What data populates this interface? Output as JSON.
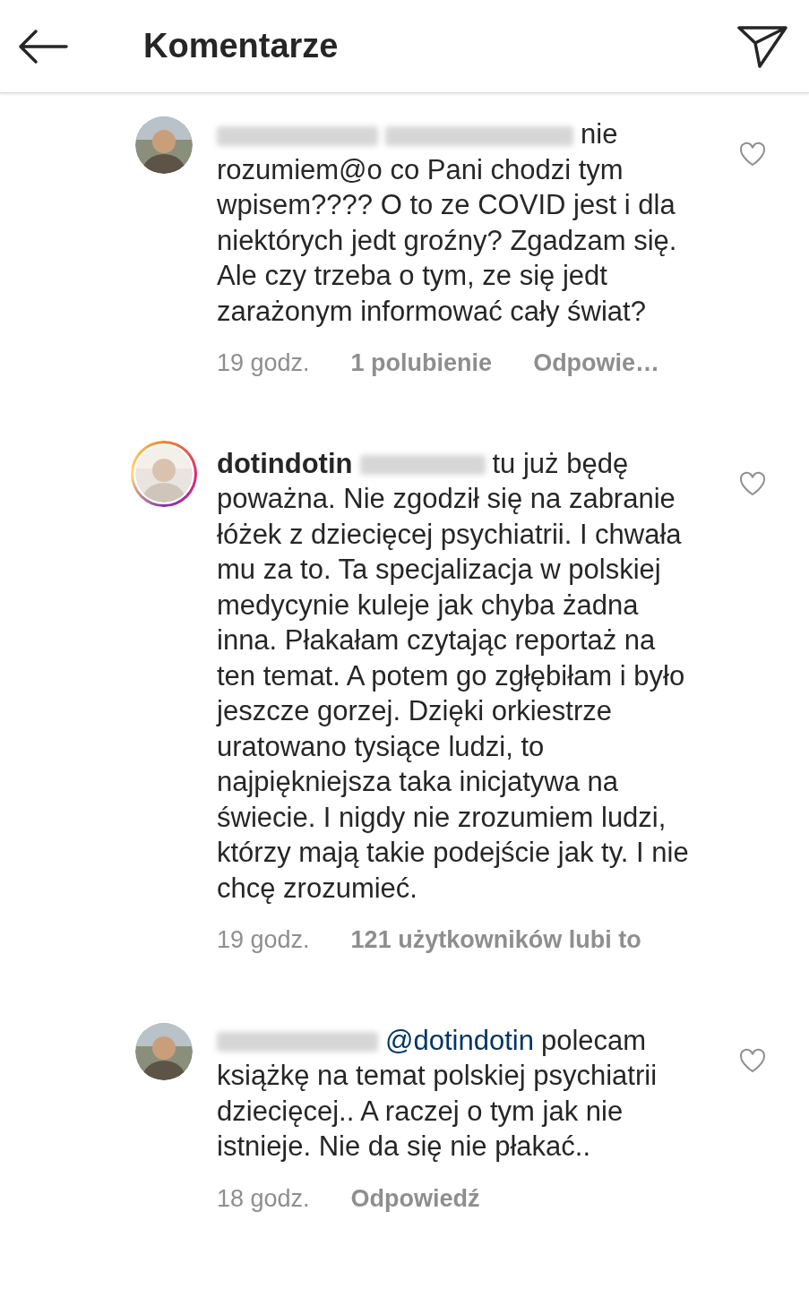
{
  "header": {
    "title": "Komentarze"
  },
  "comments": [
    {
      "username_hidden": true,
      "mention_hidden": true,
      "story_ring": false,
      "text": "nie rozumiem@o co Pani chodzi tym wpisem???? O to ze COVID jest i dla niektórych jedt groźny? Zgadzam się. Ale czy trzeba o tym, ze się jedt zarażonym informować cały świat?",
      "time": "19 godz.",
      "likes": "1 polubienie",
      "reply": "Odpowie…"
    },
    {
      "username": "dotindotin",
      "mention_hidden": true,
      "story_ring": true,
      "text": "tu już będę poważna. Nie zgodził się na zabranie łóżek z dziecięcej psychiatrii. I chwała mu za to. Ta specjalizacja w polskiej medycynie kuleje jak chyba żadna inna. Płakałam czytając reportaż na ten temat. A potem go zgłębiłam i było jeszcze gorzej. Dzięki orkiestrze uratowano tysiące ludzi, to najpiękniejsza taka inicjatywa na świecie. I nigdy nie zrozumiem ludzi, którzy mają takie podejście jak ty. I nie chcę zrozumieć.",
      "time": "19 godz.",
      "likes": "121 użytkowników lubi to"
    },
    {
      "username_hidden": true,
      "mention": "@dotindotin",
      "story_ring": false,
      "text": "polecam książkę na temat polskiej psychiatrii dziecięcej.. A raczej o tym jak nie istnieje. Nie da się nie płakać..",
      "time": "18 godz.",
      "reply": "Odpowiedź"
    }
  ]
}
